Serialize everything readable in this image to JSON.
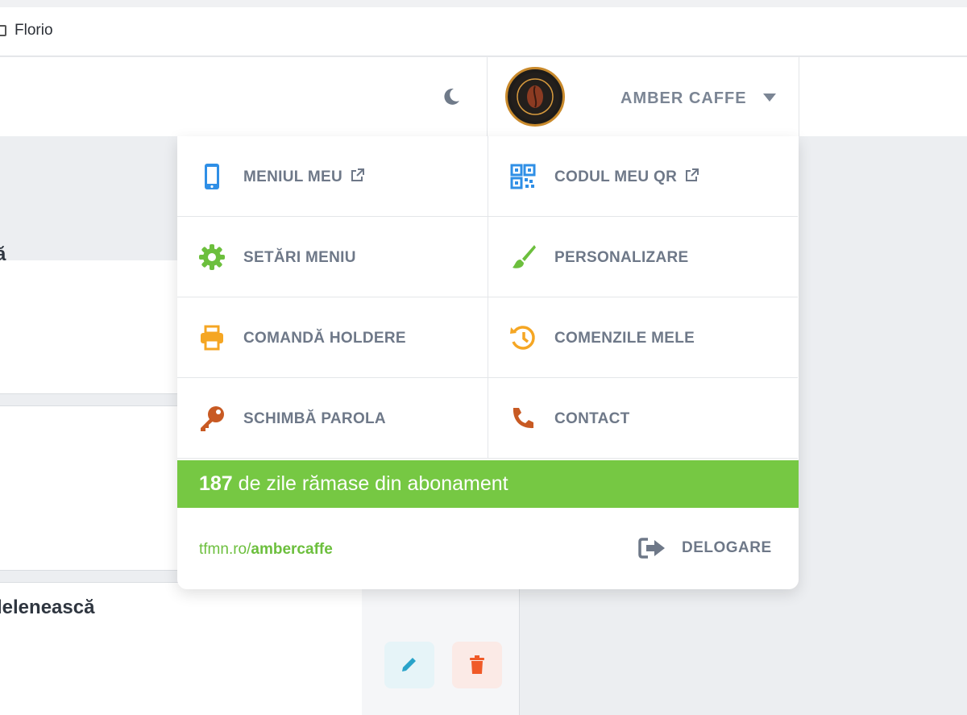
{
  "bookmarks": {
    "item_label": "Florio"
  },
  "header": {
    "account_name": "AMBER CAFFE",
    "logo_text": "AMBER CAFFE"
  },
  "background": {
    "card1_text": "ă",
    "card3_text": "lelenească"
  },
  "menu": {
    "items": [
      {
        "label": "MENIUL MEU",
        "icon": "phone-icon",
        "color": "#2f8fe6",
        "external": true
      },
      {
        "label": "CODUL MEU QR",
        "icon": "qr-code-icon",
        "color": "#2f8fe6",
        "external": true
      },
      {
        "label": "SETĂRI MENIU",
        "icon": "gear-icon",
        "color": "#6cbf3d",
        "external": false
      },
      {
        "label": "PERSONALIZARE",
        "icon": "paintbrush-icon",
        "color": "#6cbf3d",
        "external": false
      },
      {
        "label": "COMANDĂ HOLDERE",
        "icon": "printer-icon",
        "color": "#f5a623",
        "external": false
      },
      {
        "label": "COMENZILE MELE",
        "icon": "history-icon",
        "color": "#f5a623",
        "external": false
      },
      {
        "label": "SCHIMBĂ PAROLA",
        "icon": "key-icon",
        "color": "#c85a23",
        "external": false
      },
      {
        "label": "CONTACT",
        "icon": "phone-handset-icon",
        "color": "#c85a23",
        "external": false
      }
    ]
  },
  "subscription": {
    "days": "187",
    "text": " de zile rămase din abonament",
    "color": "#76c843"
  },
  "footer": {
    "link_prefix": "tfmn.ro/",
    "link_slug": "ambercaffe",
    "logout_label": "DELOGARE"
  }
}
